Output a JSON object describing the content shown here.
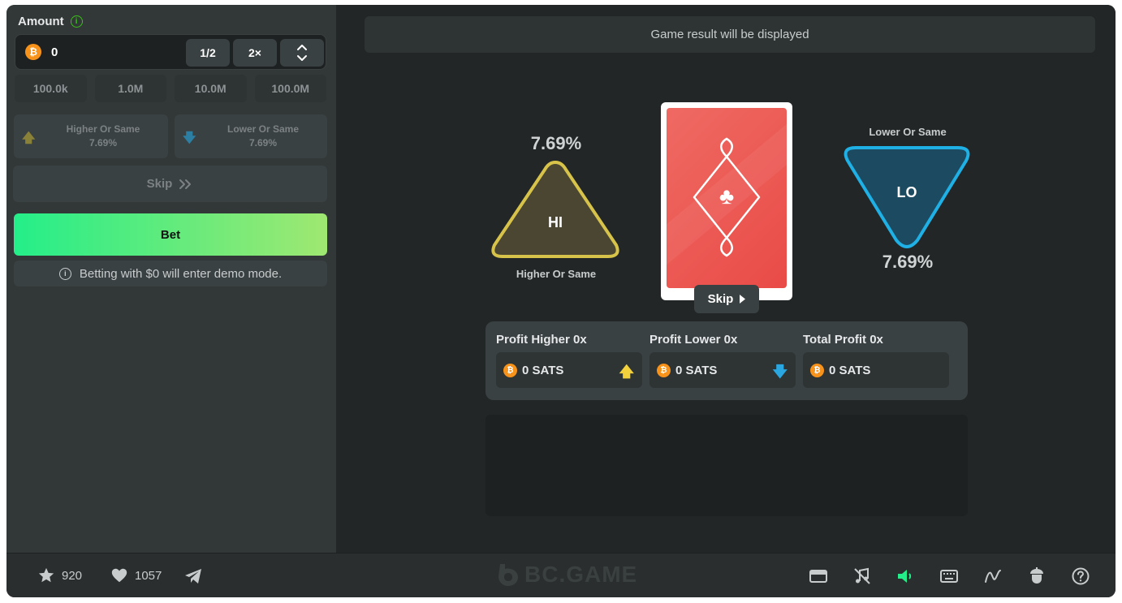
{
  "controls": {
    "amount_label": "Amount",
    "amount_value": "0",
    "half_label": "1/2",
    "double_label": "2×",
    "quick_amounts": [
      "100.0k",
      "1.0M",
      "10.0M",
      "100.0M"
    ],
    "higher": {
      "label": "Higher Or Same",
      "pct": "7.69%"
    },
    "lower": {
      "label": "Lower Or Same",
      "pct": "7.69%"
    },
    "skip_label": "Skip",
    "bet_label": "Bet",
    "demo_note": "Betting with $0 will enter demo mode."
  },
  "game": {
    "result_text": "Game result will be displayed",
    "hi": {
      "pct": "7.69%",
      "symbol": "HI",
      "label": "Higher Or Same"
    },
    "lo": {
      "pct": "7.69%",
      "symbol": "LO",
      "label": "Lower Or Same"
    },
    "card": {
      "suit": "clubs",
      "back_color": "#e94b47"
    },
    "card_skip": "Skip",
    "profits": [
      {
        "title": "Profit Higher 0x",
        "value": "0 SATS",
        "arrow": "up",
        "arrow_color": "#f2d13c"
      },
      {
        "title": "Profit Lower 0x",
        "value": "0 SATS",
        "arrow": "down",
        "arrow_color": "#2aa7e0"
      },
      {
        "title": "Total Profit 0x",
        "value": "0 SATS"
      }
    ]
  },
  "footer": {
    "favorites": "920",
    "likes": "1057",
    "logo": "BC.GAME",
    "icons": [
      "star-icon",
      "heart-icon",
      "telegram-icon",
      "theater-mode-icon",
      "music-off-icon",
      "sound-icon",
      "keyboard-icon",
      "live-stats-icon",
      "fairness-icon",
      "help-icon"
    ]
  },
  "colors": {
    "accent_green": "#24ee89",
    "panel": "#323738",
    "background": "#232626",
    "hi_border": "#d7c34a",
    "lo_border": "#1fb0e5"
  }
}
